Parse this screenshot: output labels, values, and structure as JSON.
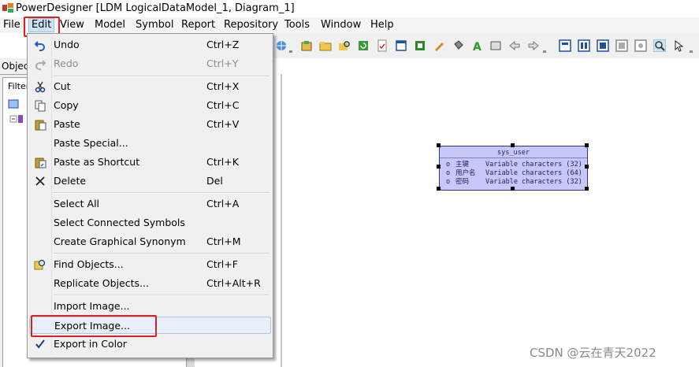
{
  "window": {
    "title": "PowerDesigner [LDM LogicalDataModel_1, Diagram_1]"
  },
  "menubar": {
    "items": [
      "File",
      "Edit",
      "View",
      "Model",
      "Symbol",
      "Report",
      "Repository",
      "Tools",
      "Window",
      "Help"
    ]
  },
  "left_panel": {
    "object_tab": "Objec",
    "filter_label": "Filter:"
  },
  "edit_menu": {
    "items": [
      {
        "label": "Undo",
        "shortcut": "Ctrl+Z",
        "icon": "undo-icon"
      },
      {
        "label": "Redo",
        "shortcut": "Ctrl+Y",
        "icon": "redo-icon",
        "disabled": true
      },
      {
        "label": "Cut",
        "shortcut": "Ctrl+X",
        "icon": "scissors-icon"
      },
      {
        "label": "Copy",
        "shortcut": "Ctrl+C",
        "icon": "copy-icon"
      },
      {
        "label": "Paste",
        "shortcut": "Ctrl+V",
        "icon": "paste-icon"
      },
      {
        "label": "Paste Special...",
        "shortcut": ""
      },
      {
        "label": "Paste as Shortcut",
        "shortcut": "Ctrl+K",
        "icon": "paste-shortcut-icon"
      },
      {
        "label": "Delete",
        "shortcut": "Del",
        "icon": "delete-x-icon"
      },
      {
        "label": "Select All",
        "shortcut": "Ctrl+A"
      },
      {
        "label": "Select Connected Symbols",
        "shortcut": ""
      },
      {
        "label": "Create Graphical Synonym",
        "shortcut": "Ctrl+M"
      },
      {
        "label": "Find Objects...",
        "shortcut": "Ctrl+F",
        "icon": "find-objects-icon"
      },
      {
        "label": "Replicate Objects...",
        "shortcut": "Ctrl+Alt+R"
      },
      {
        "label": "Import Image...",
        "shortcut": ""
      },
      {
        "label": "Export Image...",
        "shortcut": "",
        "highlighted": true
      },
      {
        "label": "Export in Color",
        "shortcut": "",
        "checked": true,
        "icon": "checkmark-icon"
      }
    ]
  },
  "entity": {
    "name": "sys_user",
    "attributes": [
      {
        "bullet": "o",
        "name": "主键",
        "type": "Variable characters (32)"
      },
      {
        "bullet": "o",
        "name": "用户名",
        "type": "Variable characters (64)"
      },
      {
        "bullet": "o",
        "name": "密码",
        "type": "Variable characters (32)"
      }
    ]
  },
  "watermark": "CSDN @云在青天2022",
  "colors": {
    "entity_fill": "#c6c8f8",
    "highlight_box": "#e02020",
    "menu_bg": "#f0f0f0"
  }
}
